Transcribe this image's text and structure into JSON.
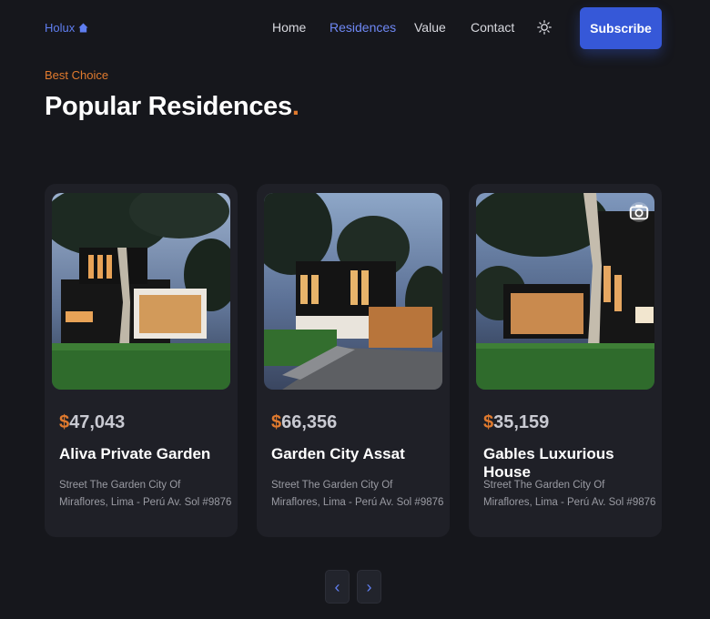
{
  "header": {
    "logo": "Holux",
    "nav": [
      "Home",
      "Residences",
      "Value",
      "Contact"
    ],
    "active_nav": "Residences",
    "subscribe_label": "Subscribe"
  },
  "section": {
    "subtitle": "Best Choice",
    "title": "Popular Residences",
    "title_dot": "."
  },
  "cards": [
    {
      "currency": "$",
      "price": "47,043",
      "name": "Aliva Private Garden",
      "address": "Street The Garden City Of Miraflores, Lima - Perú Av. Sol #9876"
    },
    {
      "currency": "$",
      "price": "66,356",
      "name": "Garden City Assat",
      "address": "Street The Garden City Of Miraflores, Lima - Perú Av. Sol #9876"
    },
    {
      "currency": "$",
      "price": "35,159",
      "name": "Gables Luxurious House",
      "address": "Street The Garden City Of Miraflores, Lima - Perú Av. Sol #9876"
    }
  ],
  "pager": {
    "prev": "‹",
    "next": "›"
  },
  "colors": {
    "accent": "#3658d8",
    "orange": "#e07a2e",
    "background": "#16171c",
    "card": "#1f2027"
  }
}
